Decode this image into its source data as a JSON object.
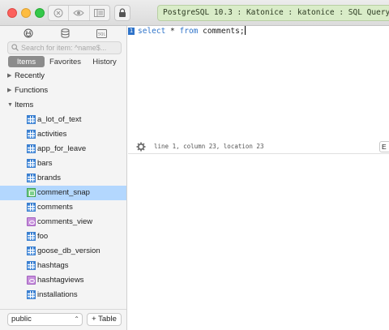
{
  "titlebar": {
    "connection": "PostgreSQL 10.3 : Katonice : katonice : SQL Query"
  },
  "sidebar": {
    "search_placeholder": "Search for item: ^name$...",
    "tabs": [
      "Items",
      "Favorites",
      "History"
    ],
    "sections": [
      "Recently",
      "Functions",
      "Items"
    ],
    "items": [
      {
        "label": "a_lot_of_text",
        "icon": "table-icon"
      },
      {
        "label": "activities",
        "icon": "table-icon"
      },
      {
        "label": "app_for_leave",
        "icon": "table-icon"
      },
      {
        "label": "bars",
        "icon": "table-icon"
      },
      {
        "label": "brands",
        "icon": "table-icon"
      },
      {
        "label": "comment_snap",
        "icon": "snapshot-icon"
      },
      {
        "label": "comments",
        "icon": "table-icon"
      },
      {
        "label": "comments_view",
        "icon": "view-icon"
      },
      {
        "label": "foo",
        "icon": "table-icon"
      },
      {
        "label": "goose_db_version",
        "icon": "table-icon"
      },
      {
        "label": "hashtags",
        "icon": "table-icon"
      },
      {
        "label": "hashtagviews",
        "icon": "view-icon"
      },
      {
        "label": "installations",
        "icon": "table-icon"
      }
    ],
    "schema": "public",
    "add_table_label": "+ Table"
  },
  "editor": {
    "line_number": "1",
    "code_kw1": "select",
    "code_star": " * ",
    "code_kw2": "from",
    "code_rest": " comments;",
    "status": "line 1, column 23, location 23",
    "explain_label": "E"
  },
  "colors": {
    "selection": "#b3d7fe",
    "keyword": "#2e73c9",
    "connection_bg": "#d9ecc8"
  }
}
